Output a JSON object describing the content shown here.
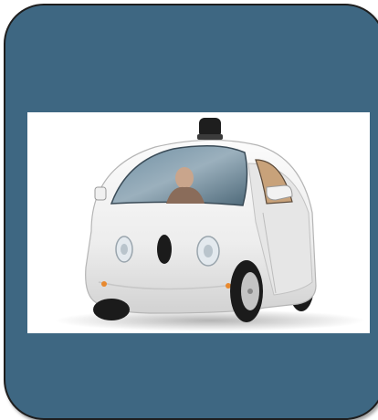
{
  "card": {
    "background_color": "#3e6782",
    "border_color": "#1e1e1e"
  },
  "photo": {
    "subject": "car-photo",
    "background_color": "#ffffff"
  }
}
